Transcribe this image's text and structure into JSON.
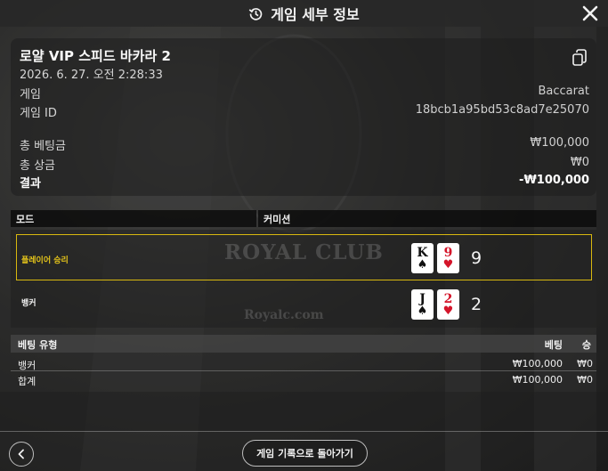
{
  "header": {
    "title": "게임 세부 정보",
    "icon": "history-icon",
    "close_icon": "close-icon"
  },
  "info": {
    "title": "로얄 VIP 스피드 바카라 2",
    "datetime": "2026. 6. 27. 오전 2:28:33",
    "game_label": "게임",
    "game_value": "Baccarat",
    "game_id_label": "게임 ID",
    "game_id_value": "18bcb1a95bd53c8ad7e25070",
    "total_bet_label": "총 베팅금",
    "total_bet_value": "₩100,000",
    "total_win_label": "총 상금",
    "total_win_value": "₩0",
    "result_label": "결과",
    "result_value": "-₩100,000",
    "copy_icon": "copy-icon"
  },
  "mode_bar": {
    "mode": "모드",
    "commission": "커미션"
  },
  "results": {
    "player": {
      "label": "플레이어 승리",
      "cards": [
        {
          "rank": "K",
          "suit": "♠",
          "color": "black"
        },
        {
          "rank": "9",
          "suit": "♥",
          "color": "red"
        }
      ],
      "score": "9"
    },
    "banker": {
      "label": "뱅커",
      "cards": [
        {
          "rank": "J",
          "suit": "♠",
          "color": "black"
        },
        {
          "rank": "2",
          "suit": "♥",
          "color": "red"
        }
      ],
      "score": "2"
    }
  },
  "bets": {
    "headers": {
      "type": "베팅 유형",
      "bet": "베팅",
      "win": "승"
    },
    "rows": [
      {
        "type": "뱅커",
        "bet": "₩100,000",
        "win": "₩0"
      }
    ],
    "total": {
      "type": "합계",
      "bet": "₩100,000",
      "win": "₩0"
    }
  },
  "footer": {
    "back_icon": "chevron-left-icon",
    "history_button": "게임 기록으로 돌아가기"
  },
  "colors": {
    "highlight_border": "#d8b80f",
    "player_win_label": "#e3c31a",
    "card_red": "#d4152a"
  }
}
